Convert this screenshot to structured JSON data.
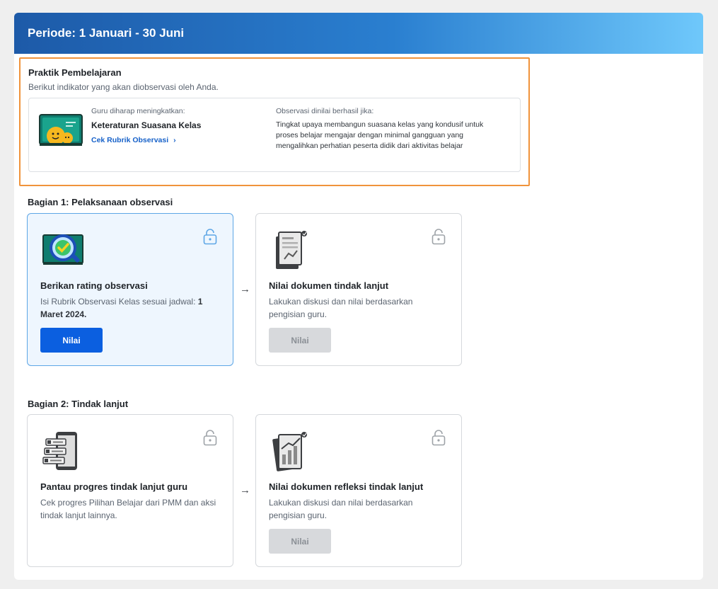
{
  "header": {
    "title": "Periode: 1 Januari - 30 Juni"
  },
  "practice": {
    "title": "Praktik Pembelajaran",
    "subtitle": "Berikut indikator yang akan diobservasi oleh Anda.",
    "indicator": {
      "goal_caption": "Guru diharap meningkatkan:",
      "goal_title": "Keteraturan Suasana Kelas",
      "rubric_link": "Cek Rubrik Observasi",
      "success_caption": "Observasi dinilai berhasil jika:",
      "success_description": "Tingkat upaya membangun suasana kelas yang kondusif untuk proses belajar mengajar dengan minimal gangguan yang mengalihkan perhatian peserta didik dari aktivitas belajar"
    }
  },
  "section1": {
    "title": "Bagian 1: Pelaksanaan observasi",
    "cards": [
      {
        "title": "Berikan rating observasi",
        "desc_prefix": "Isi Rubrik Observasi Kelas sesuai jadwal: ",
        "desc_date": "1 Maret 2024.",
        "button": "Nilai"
      },
      {
        "title": "Nilai dokumen tindak lanjut",
        "description": "Lakukan diskusi dan nilai berdasarkan pengisian guru.",
        "button": "Nilai"
      }
    ]
  },
  "section2": {
    "title": "Bagian 2: Tindak lanjut",
    "cards": [
      {
        "title": "Pantau progres tindak lanjut guru",
        "description": "Cek progres Pilihan Belajar dari PMM dan aksi tindak lanjut lainnya."
      },
      {
        "title": "Nilai dokumen refleksi tindak lanjut",
        "description": "Lakukan diskusi dan nilai berdasarkan pengisian guru.",
        "button": "Nilai"
      }
    ]
  },
  "icons": {
    "arrow": "→",
    "chevron": "›"
  },
  "colors": {
    "primary": "#0b5fe0",
    "highlight_border": "#f0933b",
    "active_card_bg": "#eef6fe"
  }
}
